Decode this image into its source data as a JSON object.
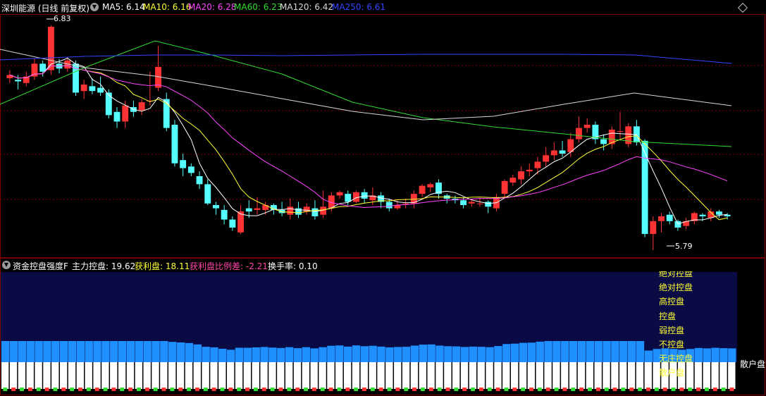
{
  "header": {
    "stock": "深圳能源 (日线 前复权)",
    "ma": [
      {
        "label": "MA5: 6.14",
        "color": "#ffffff"
      },
      {
        "label": "MA10: 6.16",
        "color": "#ffff33"
      },
      {
        "label": "MA20: 6.28",
        "color": "#ff44ff"
      },
      {
        "label": "MA60: 6.23",
        "color": "#33dd33"
      },
      {
        "label": "MA120: 6.42",
        "color": "#d8d8d8"
      },
      {
        "label": "MA250: 6.61",
        "color": "#3344ff"
      }
    ]
  },
  "price_chart": {
    "high_label": "6.83",
    "low_label": "5.79",
    "up_color": "#ff3333",
    "down_color": "#55ffff"
  },
  "indicator": {
    "name": "资金控盘强度F",
    "items": [
      {
        "label": "主力控盘: 19.62",
        "color": "#ffffff"
      },
      {
        "label": "获利盘: 18.11",
        "color": "#ffff33"
      },
      {
        "label": "获利盘比例差: -2.21",
        "color": "#ff44aa"
      },
      {
        "label": "换手率: 0.10",
        "color": "#ffffff"
      }
    ],
    "levels": [
      "绝对控盘",
      "绝对控盘",
      "高控盘",
      "控盘",
      "弱控盘",
      "不控盘",
      "无庄控盘",
      "散户盘"
    ],
    "right_label": "散户盘"
  },
  "chart_data": {
    "type": "candlestick",
    "candles": [
      [
        6.51,
        6.53,
        6.48,
        6.56
      ],
      [
        6.5,
        6.49,
        6.44,
        6.53
      ],
      [
        6.48,
        6.52,
        6.46,
        6.55
      ],
      [
        6.52,
        6.6,
        6.5,
        6.63
      ],
      [
        6.6,
        6.55,
        6.52,
        6.62
      ],
      [
        6.56,
        6.83,
        6.53,
        6.84
      ],
      [
        6.6,
        6.57,
        6.54,
        6.63
      ],
      [
        6.57,
        6.62,
        6.55,
        6.64
      ],
      [
        6.6,
        6.42,
        6.4,
        6.62
      ],
      [
        6.43,
        6.47,
        6.38,
        6.5
      ],
      [
        6.46,
        6.43,
        6.41,
        6.51
      ],
      [
        6.45,
        6.42,
        6.4,
        6.52
      ],
      [
        6.42,
        6.28,
        6.26,
        6.44
      ],
      [
        6.3,
        6.24,
        6.2,
        6.33
      ],
      [
        6.24,
        6.34,
        6.2,
        6.37
      ],
      [
        6.33,
        6.3,
        6.27,
        6.37
      ],
      [
        6.31,
        6.36,
        6.28,
        6.38
      ],
      [
        6.37,
        6.37,
        6.34,
        6.55
      ],
      [
        6.45,
        6.58,
        6.43,
        6.71
      ],
      [
        6.38,
        6.2,
        6.18,
        6.42
      ],
      [
        6.22,
        5.98,
        5.96,
        6.25
      ],
      [
        6.0,
        5.95,
        5.9,
        6.04
      ],
      [
        5.96,
        5.92,
        5.9,
        5.98
      ],
      [
        5.9,
        5.85,
        5.82,
        5.93
      ],
      [
        5.85,
        5.73,
        5.72,
        5.88
      ],
      [
        5.72,
        5.7,
        5.66,
        5.74
      ],
      [
        5.69,
        5.63,
        5.6,
        5.72
      ],
      [
        5.63,
        5.58,
        5.56,
        5.65
      ],
      [
        5.55,
        5.68,
        5.54,
        5.72
      ],
      [
        5.7,
        5.68,
        5.64,
        5.75
      ],
      [
        5.69,
        5.7,
        5.66,
        5.77
      ],
      [
        5.69,
        5.72,
        5.66,
        5.74
      ],
      [
        5.72,
        5.69,
        5.66,
        5.73
      ],
      [
        5.69,
        5.67,
        5.65,
        5.74
      ],
      [
        5.66,
        5.71,
        5.63,
        5.76
      ],
      [
        5.7,
        5.66,
        5.64,
        5.74
      ],
      [
        5.68,
        5.71,
        5.66,
        5.73
      ],
      [
        5.7,
        5.65,
        5.63,
        5.75
      ],
      [
        5.66,
        5.71,
        5.64,
        5.81
      ],
      [
        5.7,
        5.78,
        5.68,
        5.8
      ],
      [
        5.78,
        5.8,
        5.76,
        5.81
      ],
      [
        5.79,
        5.74,
        5.72,
        5.81
      ],
      [
        5.74,
        5.8,
        5.73,
        5.81
      ],
      [
        5.8,
        5.76,
        5.73,
        5.82
      ],
      [
        5.75,
        5.78,
        5.72,
        5.83
      ],
      [
        5.78,
        5.74,
        5.7,
        5.8
      ],
      [
        5.74,
        5.7,
        5.68,
        5.76
      ],
      [
        5.7,
        5.72,
        5.69,
        5.75
      ],
      [
        5.73,
        5.73,
        5.7,
        5.76
      ],
      [
        5.73,
        5.79,
        5.7,
        5.81
      ],
      [
        5.79,
        5.84,
        5.77,
        5.85
      ],
      [
        5.83,
        5.85,
        5.8,
        5.86
      ],
      [
        5.86,
        5.79,
        5.76,
        5.88
      ],
      [
        5.78,
        5.76,
        5.73,
        5.79
      ],
      [
        5.76,
        5.75,
        5.73,
        5.78
      ],
      [
        5.75,
        5.72,
        5.7,
        5.77
      ],
      [
        5.73,
        5.74,
        5.71,
        5.76
      ],
      [
        5.73,
        5.73,
        5.71,
        5.76
      ],
      [
        5.74,
        5.71,
        5.67,
        5.75
      ],
      [
        5.7,
        5.77,
        5.68,
        5.79
      ],
      [
        5.79,
        5.87,
        5.77,
        5.88
      ],
      [
        5.86,
        5.89,
        5.84,
        5.91
      ],
      [
        5.88,
        5.93,
        5.85,
        5.96
      ],
      [
        5.93,
        5.94,
        5.9,
        5.98
      ],
      [
        5.95,
        5.99,
        5.91,
        6.02
      ],
      [
        5.99,
        6.03,
        5.96,
        6.08
      ],
      [
        6.03,
        6.06,
        6.0,
        6.11
      ],
      [
        6.06,
        6.04,
        6.02,
        6.12
      ],
      [
        6.05,
        6.13,
        6.02,
        6.17
      ],
      [
        6.13,
        6.2,
        6.11,
        6.27
      ],
      [
        6.2,
        6.22,
        6.17,
        6.26
      ],
      [
        6.22,
        6.13,
        6.1,
        6.24
      ],
      [
        6.13,
        6.1,
        6.06,
        6.16
      ],
      [
        6.1,
        6.19,
        6.07,
        6.21
      ],
      [
        6.18,
        6.18,
        6.13,
        6.3
      ],
      [
        6.1,
        6.21,
        6.08,
        6.23
      ],
      [
        6.21,
        6.11,
        6.09,
        6.25
      ],
      [
        6.12,
        5.54,
        5.52,
        6.13
      ],
      [
        5.54,
        5.62,
        5.44,
        5.65
      ],
      [
        5.62,
        5.65,
        5.55,
        5.67
      ],
      [
        5.66,
        5.62,
        5.6,
        5.68
      ],
      [
        5.62,
        5.58,
        5.56,
        5.63
      ],
      [
        5.59,
        5.62,
        5.57,
        5.64
      ],
      [
        5.62,
        5.67,
        5.6,
        5.68
      ],
      [
        5.66,
        5.65,
        5.62,
        5.67
      ],
      [
        5.64,
        5.68,
        5.62,
        5.7
      ],
      [
        5.68,
        5.66,
        5.64,
        5.69
      ],
      [
        5.66,
        5.65,
        5.63,
        5.67
      ]
    ],
    "ylim": [
      5.4,
      6.9
    ]
  }
}
